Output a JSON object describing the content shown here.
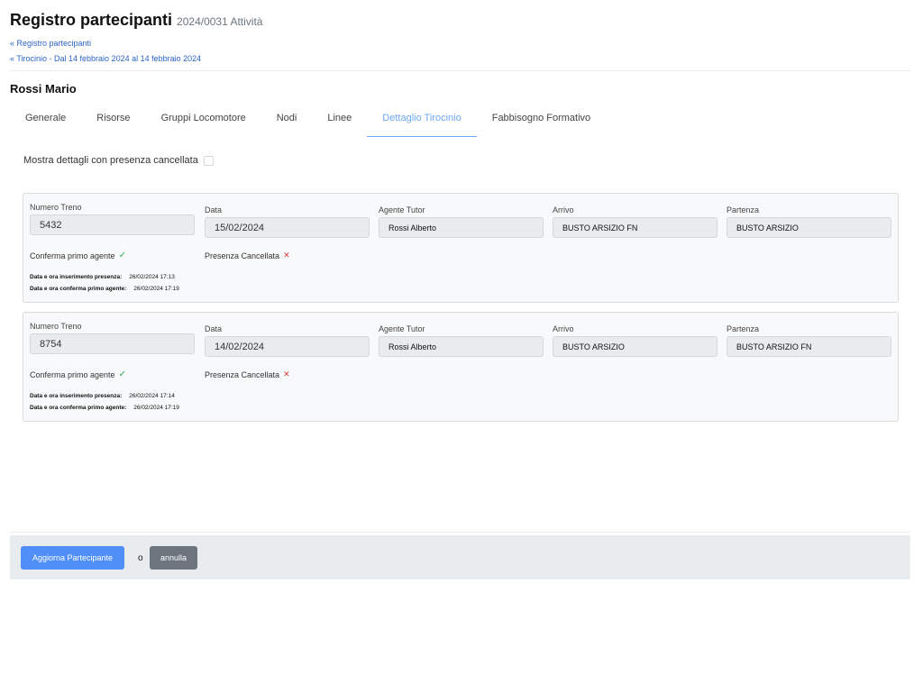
{
  "header": {
    "title": "Registro partecipanti",
    "subtitle": "2024/0031 Attività"
  },
  "breadcrumbs": [
    "« Registro partecipanti",
    "« Tirocinio - Dal 14 febbraio 2024 al 14 febbraio 2024"
  ],
  "participant_name": "Rossi Mario",
  "tabs": [
    {
      "label": "Generale",
      "active": false
    },
    {
      "label": "Risorse",
      "active": false
    },
    {
      "label": "Gruppi Locomotore",
      "active": false
    },
    {
      "label": "Nodi",
      "active": false
    },
    {
      "label": "Linee",
      "active": false
    },
    {
      "label": "Dettaglio Tirocinio",
      "active": true
    },
    {
      "label": "Fabbisogno Formativo",
      "active": false
    }
  ],
  "show_cancelled": {
    "label": "Mostra dettagli con presenza cancellata",
    "checked": false
  },
  "field_labels": {
    "train_number": "Numero Treno",
    "date": "Data",
    "tutor": "Agente Tutor",
    "arrival": "Arrivo",
    "departure": "Partenza",
    "confirm_first_agent": "Conferma primo agente",
    "presence_cancelled": "Presenza Cancellata",
    "insert_datetime": "Data e ora inserimento presenza:",
    "confirm_datetime": "Data e ora conferma primo agente:"
  },
  "icons": {
    "confirmed": "check-icon",
    "cancelled": "cross-icon"
  },
  "colors": {
    "accent": "#4f8ff7",
    "tab_active": "#6ea8f0",
    "check": "#2eab57",
    "cross": "#d93a3a"
  },
  "records": [
    {
      "train_number": "5432",
      "date": "15/02/2024",
      "tutor": "Rossi Alberto",
      "arrival": "BUSTO ARSIZIO FN",
      "departure": "BUSTO ARSIZIO",
      "confirm_first_agent": true,
      "presence_cancelled": false,
      "insert_datetime": "26/02/2024 17:13",
      "confirm_datetime": "26/02/2024 17:19"
    },
    {
      "train_number": "8754",
      "date": "14/02/2024",
      "tutor": "Rossi Alberto",
      "arrival": "BUSTO ARSIZIO",
      "departure": "BUSTO ARSIZIO FN",
      "confirm_first_agent": true,
      "presence_cancelled": false,
      "insert_datetime": "26/02/2024 17:14",
      "confirm_datetime": "26/02/2024 17:19"
    }
  ],
  "footer": {
    "update_label": "Aggiorna Partecipante",
    "or_label": "o",
    "cancel_label": "annulla"
  }
}
